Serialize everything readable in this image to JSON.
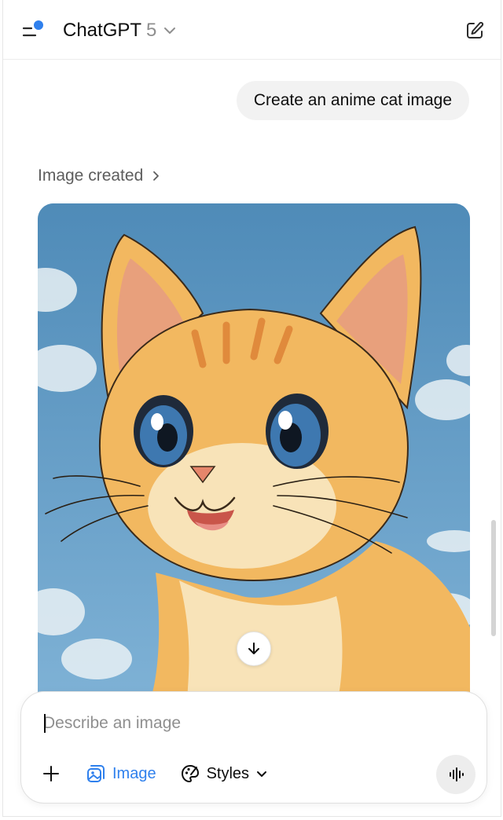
{
  "header": {
    "model_name": "ChatGPT",
    "model_version": "5"
  },
  "conversation": {
    "user_message": "Create an anime cat image",
    "status_label": "Image created"
  },
  "composer": {
    "placeholder": "Describe an image",
    "value": "",
    "tool_image_label": "Image",
    "tool_styles_label": "Styles"
  },
  "colors": {
    "accent_blue": "#2f80ed",
    "notification_dot": "#2f80ed",
    "bubble_bg": "#f2f2f2",
    "sky": "#5e9ac4",
    "cat_fur": "#f2b860"
  },
  "icons": {
    "sidebar": "sidebar-toggle-icon",
    "new_chat": "compose-icon",
    "model_dropdown": "chevron-down-icon",
    "status_chevron": "chevron-right-icon",
    "scroll_down": "arrow-down-icon",
    "add": "plus-icon",
    "image_tool": "image-icon",
    "styles_tool": "palette-icon",
    "styles_dropdown": "chevron-down-icon",
    "voice": "voice-waveform-icon"
  }
}
